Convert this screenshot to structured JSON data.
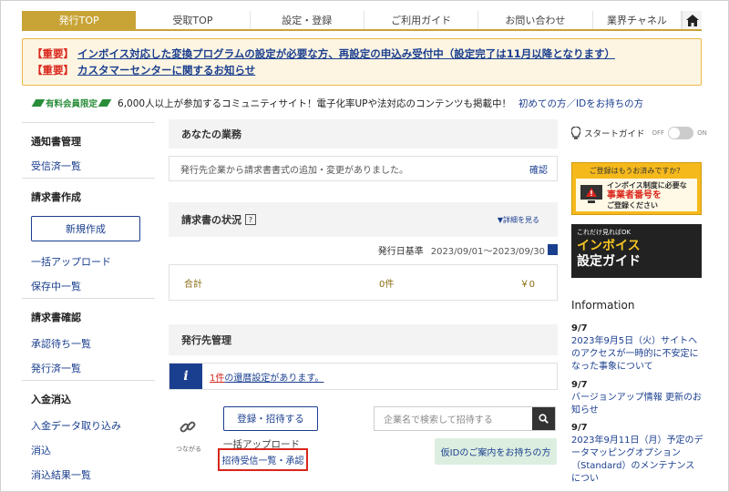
{
  "nav": {
    "tabs": [
      "発行TOP",
      "受取TOP",
      "設定・登録",
      "ご利用ガイド",
      "お問い合わせ",
      "業界チャネル"
    ],
    "active": "発行TOP"
  },
  "notices": [
    {
      "tag": "【重要】",
      "text": "インボイス対応した変換プログラムの設定が必要な方、再設定の申込み受付中（設定完了は11月以降となります）"
    },
    {
      "tag": "【重要】",
      "text": "カスタマーセンターに関するお知らせ"
    }
  ],
  "community": {
    "badge": "有料会員限定",
    "text": "6,000人以上が参加するコミュニティサイト！電子化率UPや法対応のコンテンツも掲載中！",
    "link": "初めての方／IDをお持ちの方"
  },
  "sidebar": {
    "sections": [
      {
        "title": "通知書管理",
        "items": [
          "受信済一覧"
        ]
      },
      {
        "title": "請求書作成",
        "button": "新規作成",
        "items": [
          "一括アップロード",
          "保存中一覧"
        ]
      },
      {
        "title": "請求書確認",
        "items": [
          "承認待ち一覧",
          "発行済一覧"
        ]
      },
      {
        "title": "入金消込",
        "items": [
          "入金データ取り込み",
          "消込",
          "消込結果一覧"
        ]
      }
    ]
  },
  "main": {
    "business": {
      "title": "あなたの業務",
      "message": "発行先企業から請求書書式の追加・変更がありました。",
      "action": "確認"
    },
    "status": {
      "title": "請求書の状況",
      "detail": "▼詳細を見る",
      "date_label": "発行日基準",
      "date_range": "2023/09/01～2023/09/30",
      "row": {
        "label": "合計",
        "count": "0件",
        "amount": "￥0"
      }
    },
    "partners": {
      "title": "発行先管理",
      "alert_count": "1件",
      "alert_text": "の還暦設定があります。",
      "connect_label": "つながる",
      "register_button": "登録・招待する",
      "search_placeholder": "企業名で検索して招待する",
      "bulk_upload": "一括アップロード",
      "invite_list": "招待受信一覧・承認",
      "temp_id": "仮IDのご案内をお持ちの方"
    }
  },
  "right": {
    "start_guide": "スタートガイド",
    "toggle_off": "OFF",
    "toggle_on": "ON",
    "ad1": {
      "top": "ご登録はもうお済みですか？",
      "line1": "インボイス制度に必要な",
      "line2": "事業者番号を",
      "line3": "ご登録ください"
    },
    "ad2": {
      "top": "これだけ見ればOK",
      "line1": "インボイス",
      "line2": "設定ガイド"
    },
    "info_title": "Information",
    "news": [
      {
        "date": "9/7",
        "title": "2023年9月5日（火）サイトへのアクセスが一時的に不安定になった事象について"
      },
      {
        "date": "9/7",
        "title": "バージョンアップ情報 更新のお知らせ"
      },
      {
        "date": "9/7",
        "title": "2023年9月11日（月）予定のデータマッピングオプション（Standard）のメンテナンスについ"
      }
    ]
  },
  "colors": {
    "gold": "#c8a436",
    "navy": "#1b3f8f",
    "red": "#d9261c",
    "green": "#2a8d3a"
  }
}
